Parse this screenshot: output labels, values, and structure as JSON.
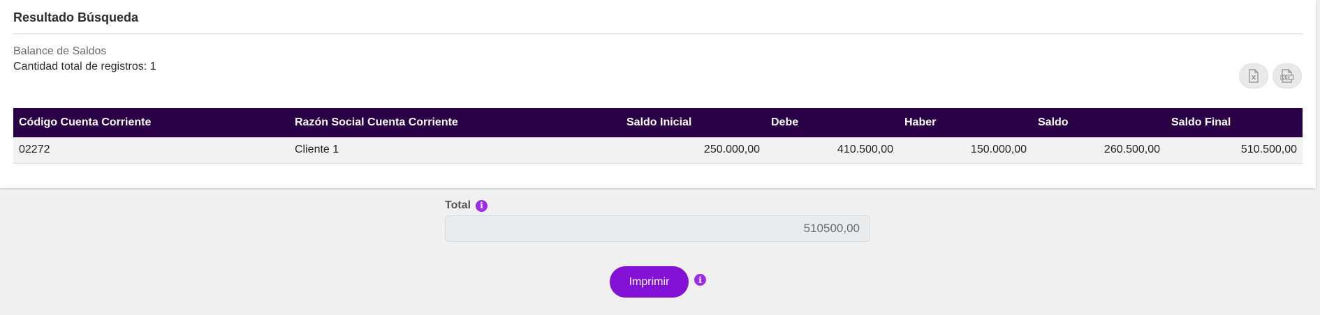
{
  "card": {
    "title": "Resultado Búsqueda",
    "subtitle": "Balance de Saldos",
    "count_label": "Cantidad total de registros:",
    "count_value": "1"
  },
  "export": {
    "xls_icon": "excel-file-icon",
    "csv_icon": "csv-file-icon"
  },
  "table": {
    "headers": [
      "Código Cuenta Corriente",
      "Razón Social Cuenta Corriente",
      "Saldo Inicial",
      "Debe",
      "Haber",
      "Saldo",
      "Saldo Final"
    ],
    "rows": [
      [
        "02272",
        "Cliente 1",
        "250.000,00",
        "410.500,00",
        "150.000,00",
        "260.500,00",
        "510.500,00"
      ]
    ]
  },
  "total": {
    "label": "Total",
    "value": "510500,00",
    "info_icon": "info-icon"
  },
  "print": {
    "label": "Imprimir",
    "info_icon": "info-icon"
  },
  "colors": {
    "header_bg": "#2a0047",
    "accent": "#8411d6",
    "info": "#9b2ee6"
  }
}
